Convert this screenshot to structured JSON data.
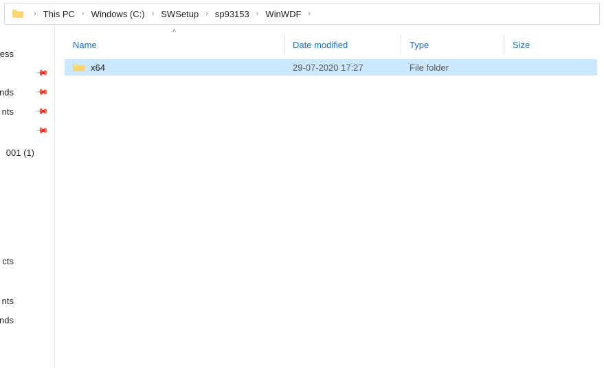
{
  "breadcrumb": [
    {
      "label": "This PC"
    },
    {
      "label": "Windows (C:)"
    },
    {
      "label": "SWSetup"
    },
    {
      "label": "sp93153"
    },
    {
      "label": "WinWDF"
    }
  ],
  "sidebar": {
    "items": [
      {
        "label": "ess",
        "pinned": true
      },
      {
        "label": "nds",
        "pinned": true
      },
      {
        "label": "nts",
        "pinned": true
      },
      {
        "label": "",
        "pinned": true
      },
      {
        "label": "001 (1)",
        "pinned": false
      },
      {
        "label": "cts",
        "pinned": false
      },
      {
        "label": "nts",
        "pinned": false
      },
      {
        "label": "nds",
        "pinned": false
      }
    ]
  },
  "columns": {
    "name": "Name",
    "date": "Date modified",
    "type": "Type",
    "size": "Size"
  },
  "files": [
    {
      "name": "x64",
      "date": "29-07-2020 17:27",
      "type": "File folder",
      "size": ""
    }
  ]
}
